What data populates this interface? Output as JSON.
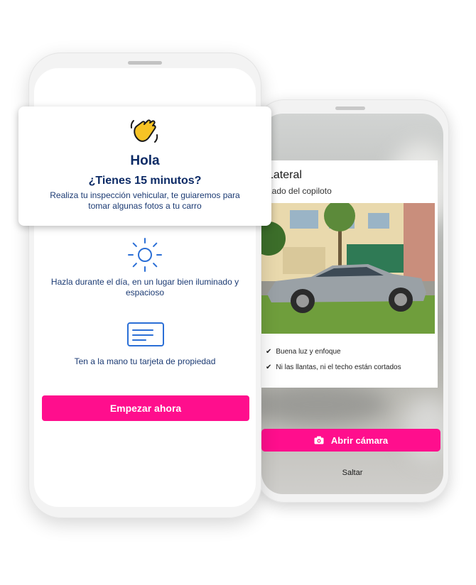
{
  "intro": {
    "title": "Hola",
    "subtitle": "¿Tienes 15 minutos?",
    "description": "Realiza tu inspección vehicular, te guiaremos para tomar algunas fotos a tu carro"
  },
  "tips": [
    {
      "icon": "sun-icon",
      "text": "Hazla durante el día, en un lugar bien iluminado y espacioso"
    },
    {
      "icon": "id-card-icon",
      "text": "Ten a la mano tu tarjeta de propiedad"
    }
  ],
  "start_button": {
    "label": "Empezar ahora"
  },
  "photo_step": {
    "title": "Lateral",
    "subtitle": "Lado del copiloto",
    "checks": [
      "Buena luz y enfoque",
      "Ni las llantas, ni el techo están cortados"
    ],
    "open_camera_label": "Abrir cámara",
    "skip_label": "Saltar"
  },
  "colors": {
    "accent": "#ff0e8d",
    "heading": "#0d2b66",
    "body_text": "#1b3a73"
  }
}
